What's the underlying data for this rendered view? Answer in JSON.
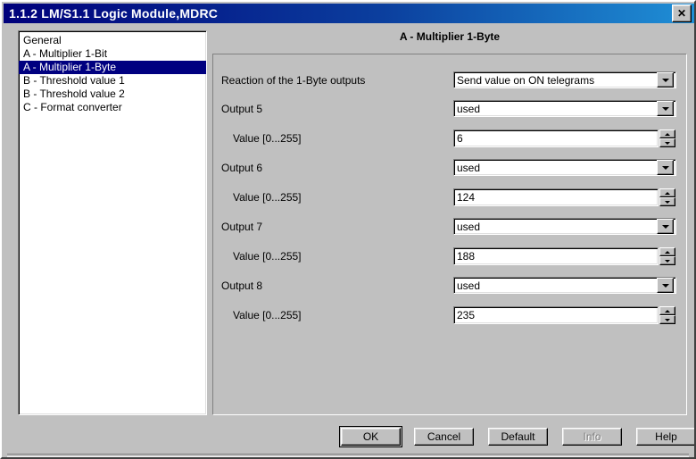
{
  "window": {
    "title": "1.1.2 LM/S1.1 Logic Module,MDRC",
    "close_icon": "close-icon",
    "close_glyph": "✕",
    "titlebar_color_left": "#00007b",
    "titlebar_color_right": "#1f8fd6",
    "face_color": "#c0c0c0",
    "selection_color": "#000080"
  },
  "sidebar": {
    "items": [
      {
        "label": "General",
        "selected": false
      },
      {
        "label": "A - Multiplier 1-Bit",
        "selected": false
      },
      {
        "label": "A - Multiplier 1-Byte",
        "selected": true
      },
      {
        "label": "B - Threshold value 1",
        "selected": false
      },
      {
        "label": "B - Threshold value 2",
        "selected": false
      },
      {
        "label": "C - Format converter",
        "selected": false
      }
    ]
  },
  "panel": {
    "title": "A - Multiplier 1-Byte",
    "rows": [
      {
        "label": "Reaction of the 1-Byte outputs",
        "type": "combo",
        "value": "Send value on ON telegrams",
        "indented": false
      },
      {
        "label": "Output 5",
        "type": "combo",
        "value": "used",
        "indented": false
      },
      {
        "label": "Value [0...255]",
        "type": "spinner",
        "value": "6",
        "indented": true
      },
      {
        "label": "Output 6",
        "type": "combo",
        "value": "used",
        "indented": false
      },
      {
        "label": "Value [0...255]",
        "type": "spinner",
        "value": "124",
        "indented": true
      },
      {
        "label": "Output 7",
        "type": "combo",
        "value": "used",
        "indented": false
      },
      {
        "label": "Value [0...255]",
        "type": "spinner",
        "value": "188",
        "indented": true
      },
      {
        "label": "Output 8",
        "type": "combo",
        "value": "used",
        "indented": false
      },
      {
        "label": "Value [0...255]",
        "type": "spinner",
        "value": "235",
        "indented": true
      }
    ]
  },
  "buttons": [
    {
      "label": "OK",
      "default": true,
      "disabled": false
    },
    {
      "label": "Cancel",
      "default": false,
      "disabled": false
    },
    {
      "label": "Default",
      "default": false,
      "disabled": false
    },
    {
      "label": "Info",
      "default": false,
      "disabled": true
    },
    {
      "label": "Help",
      "default": false,
      "disabled": false
    }
  ]
}
